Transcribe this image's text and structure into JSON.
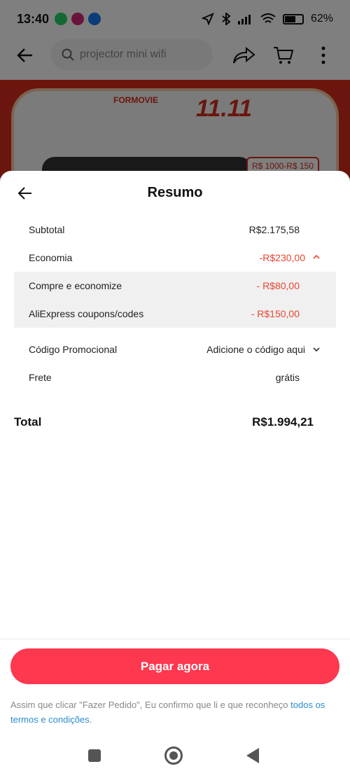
{
  "status_bar": {
    "time": "13:40",
    "battery": "62",
    "battery_unit": "%",
    "battery_level": 0.62
  },
  "search": {
    "query": "projector mini wifi"
  },
  "banner": {
    "brand": "FORMOVIE",
    "sale": "11.11",
    "coupon_badge": "R$ 1000-R$ 150"
  },
  "summary": {
    "title": "Resumo",
    "subtotal_label": "Subtotal",
    "subtotal_value": "R$2.175,58",
    "savings_label": "Economia",
    "savings_value": "-R$230,00",
    "savings_items": [
      {
        "label": "Compre e economize",
        "value": "- R$80,00"
      },
      {
        "label": "AliExpress coupons/codes",
        "value": "- R$150,00"
      }
    ],
    "promo_label": "Código Promocional",
    "promo_value": "Adicione o código aqui",
    "shipping_label": "Frete",
    "shipping_value": "grátis",
    "total_label": "Total",
    "total_value": "R$1.994,21"
  },
  "footer": {
    "pay_button": "Pagar agora",
    "terms_text": "Assim que clicar \"Fazer Pedido\", Eu confirmo que li e que reconheço ",
    "terms_link": "todos os termos e condições",
    "terms_end": "."
  },
  "colors": {
    "accent": "#fd384f",
    "discount_red": "#e8452e",
    "link_blue": "#2a8ed0"
  },
  "icons": [
    "back-arrow-icon",
    "chevron-up-icon",
    "chevron-down-icon",
    "search-icon",
    "share-icon",
    "cart-icon",
    "more-icon"
  ]
}
